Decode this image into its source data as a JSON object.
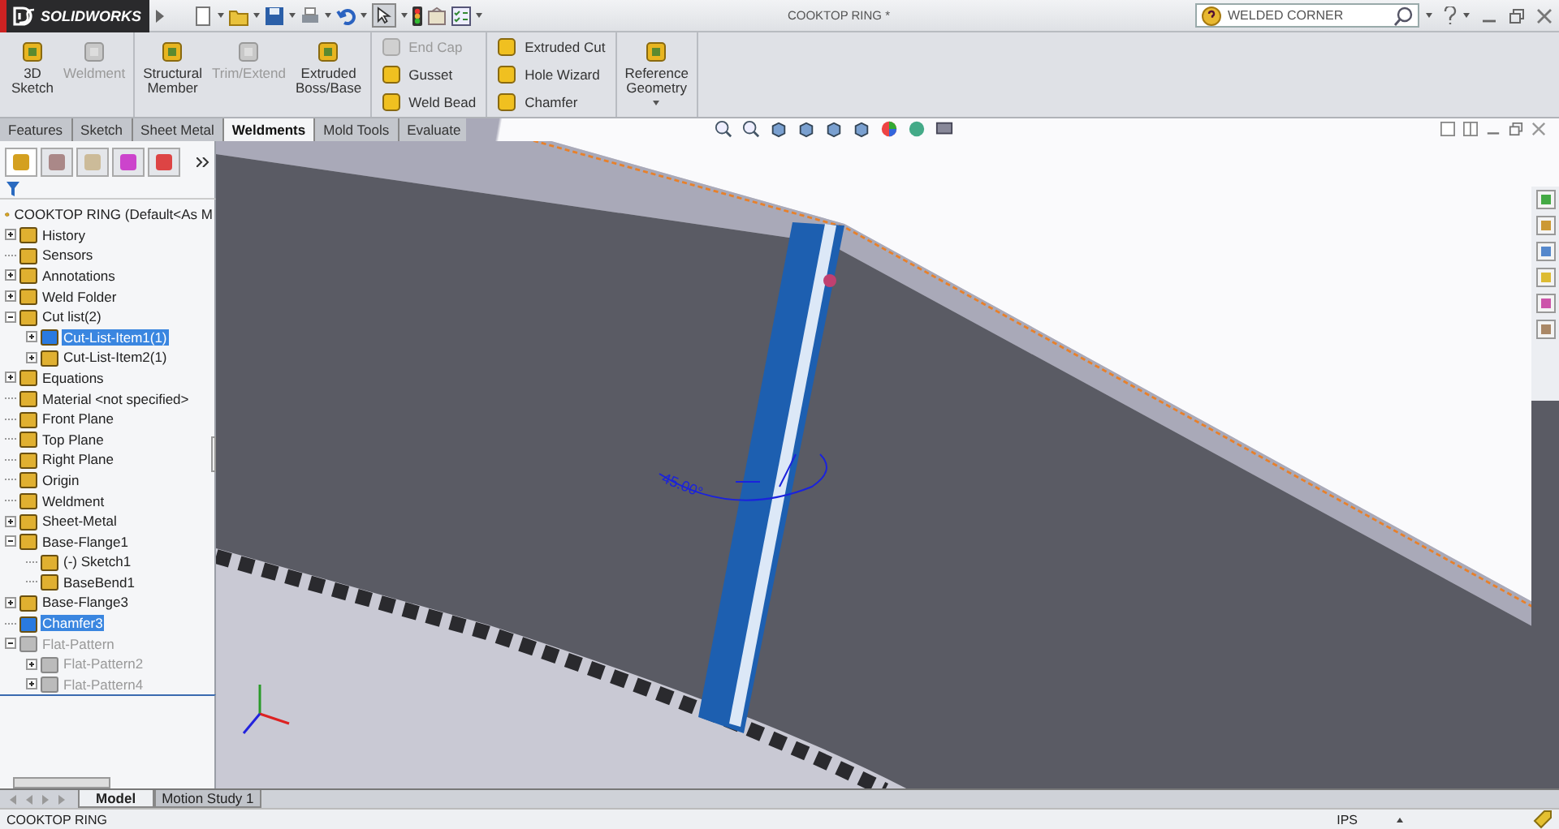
{
  "app": {
    "name": "SOLIDWORKS"
  },
  "window": {
    "title": "COOKTOP RING *"
  },
  "search": {
    "value": "WELDED CORNER"
  },
  "ribbon_groups": [
    {
      "kind": "large",
      "buttons": [
        {
          "label": "3D\nSketch",
          "disabled": false
        },
        {
          "label": "Weldment",
          "disabled": true
        }
      ]
    },
    {
      "kind": "large",
      "buttons": [
        {
          "label": "Structural\nMember",
          "disabled": false
        },
        {
          "label": "Trim/Extend",
          "disabled": true
        },
        {
          "label": "Extruded\nBoss/Base",
          "disabled": false
        }
      ]
    },
    {
      "kind": "small",
      "buttons": [
        {
          "label": "End Cap",
          "disabled": true
        },
        {
          "label": "Gusset",
          "disabled": false
        },
        {
          "label": "Weld Bead",
          "disabled": false
        }
      ]
    },
    {
      "kind": "small",
      "buttons": [
        {
          "label": "Extruded Cut",
          "disabled": false
        },
        {
          "label": "Hole Wizard",
          "disabled": false
        },
        {
          "label": "Chamfer",
          "disabled": false
        }
      ]
    },
    {
      "kind": "large",
      "buttons": [
        {
          "label": "Reference\nGeometry",
          "disabled": false,
          "dropdown": true
        }
      ]
    }
  ],
  "command_tabs": [
    {
      "label": "Features",
      "selected": false
    },
    {
      "label": "Sketch",
      "selected": false
    },
    {
      "label": "Sheet Metal",
      "selected": false
    },
    {
      "label": "Weldments",
      "selected": true
    },
    {
      "label": "Mold Tools",
      "selected": false
    },
    {
      "label": "Evaluate",
      "selected": false
    }
  ],
  "panel_tabs": [
    {
      "selected": true
    },
    {
      "selected": false
    },
    {
      "selected": false
    },
    {
      "selected": false
    },
    {
      "selected": false
    }
  ],
  "tree": {
    "root": "COOKTOP RING  (Default<As M",
    "items": [
      {
        "label": "History",
        "expanded": false,
        "selected": false,
        "disabled": false
      },
      {
        "label": "Sensors",
        "selected": false,
        "disabled": false
      },
      {
        "label": "Annotations",
        "expanded": false,
        "selected": false,
        "disabled": false
      },
      {
        "label": "Weld Folder",
        "expanded": false,
        "selected": false,
        "disabled": false
      },
      {
        "label": "Cut list(2)",
        "expanded": true,
        "selected": false,
        "disabled": false,
        "children": [
          {
            "label": "Cut-List-Item1(1)",
            "expanded": false,
            "selected": true,
            "disabled": false
          },
          {
            "label": "Cut-List-Item2(1)",
            "expanded": false,
            "selected": false,
            "disabled": false
          }
        ]
      },
      {
        "label": "Equations",
        "expanded": false,
        "selected": false,
        "disabled": false
      },
      {
        "label": "Material <not specified>",
        "selected": false,
        "disabled": false
      },
      {
        "label": "Front Plane",
        "selected": false,
        "disabled": false
      },
      {
        "label": "Top Plane",
        "selected": false,
        "disabled": false
      },
      {
        "label": "Right Plane",
        "selected": false,
        "disabled": false
      },
      {
        "label": "Origin",
        "selected": false,
        "disabled": false
      },
      {
        "label": "Weldment",
        "selected": false,
        "disabled": false
      },
      {
        "label": "Sheet-Metal",
        "expanded": false,
        "selected": false,
        "disabled": false
      },
      {
        "label": "Base-Flange1",
        "expanded": true,
        "selected": false,
        "disabled": false,
        "children": [
          {
            "label": "(-) Sketch1",
            "selected": false,
            "disabled": false
          },
          {
            "label": "BaseBend1",
            "selected": false,
            "disabled": false
          }
        ]
      },
      {
        "label": "Base-Flange3",
        "expanded": false,
        "selected": false,
        "disabled": false
      },
      {
        "label": "Chamfer3",
        "selected": true,
        "disabled": false
      },
      {
        "label": "Flat-Pattern",
        "expanded": true,
        "selected": false,
        "disabled": true,
        "children": [
          {
            "label": "Flat-Pattern2",
            "expanded": false,
            "selected": false,
            "disabled": true
          },
          {
            "label": "Flat-Pattern4",
            "expanded": false,
            "selected": false,
            "disabled": true
          }
        ]
      }
    ]
  },
  "viewport": {
    "dimension": "45.00°"
  },
  "bottom_tabs": [
    {
      "label": "Model",
      "selected": true
    },
    {
      "label": "Motion Study 1",
      "selected": false
    }
  ],
  "status_bar": {
    "document": "COOKTOP RING",
    "units": "IPS"
  }
}
